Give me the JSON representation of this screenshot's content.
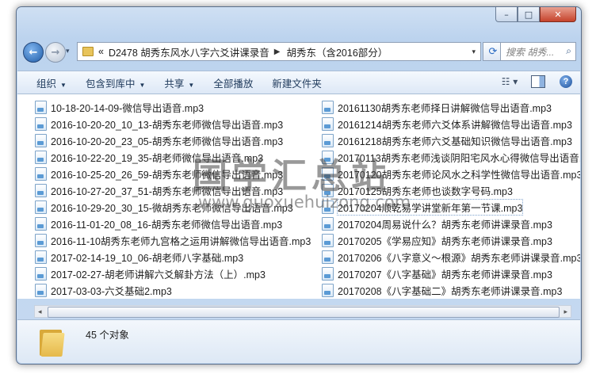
{
  "window": {
    "caption_min": "–",
    "caption_max": "□",
    "caption_close": "✕"
  },
  "nav": {
    "back_glyph": "←",
    "forward_glyph": "→",
    "history_glyph": "▾",
    "address_prefix": "«",
    "address_segments": [
      "D2478 胡秀东风水八字六爻讲课录音",
      "胡秀东（含2016部分）"
    ],
    "address_separator": "▶",
    "dropdown_glyph": "▾",
    "refresh_glyph": "⟳",
    "search_placeholder": "搜索 胡秀...",
    "search_icon": "search-icon"
  },
  "toolbar": {
    "organize": "组织",
    "include_in_library": "包含到库中",
    "share": "共享",
    "play_all": "全部播放",
    "new_folder": "新建文件夹",
    "caret": "▼",
    "view_glyph": "☷ ▾",
    "help_glyph": "?"
  },
  "files": {
    "left": [
      "10-18-20-14-09-微信导出语音.mp3",
      "2016-10-20-20_10_13-胡秀东老师微信导出语音.mp3",
      "2016-10-20-20_23_05-胡秀东老师微信导出语音.mp3",
      "2016-10-22-20_19_35-胡老师微信导出语音.mp3",
      "2016-10-25-20_26_59-胡秀东老师微信导出语音.mp3",
      "2016-10-27-20_37_51-胡秀东老师微信导出语音.mp3",
      "2016-10-29-20_30_15-微胡秀东老师微信导出语音.mp3",
      "2016-11-01-20_08_16-胡秀东老师微信导出语音.mp3",
      "2016-11-10胡秀东老师九宫格之运用讲解微信导出语音.mp3",
      "2017-02-14-19_10_06-胡老师八字基础.mp3",
      "2017-02-27-胡老师讲解六爻解卦方法（上）.mp3",
      "2017-03-03-六爻基础2.mp3"
    ],
    "right": [
      "20161130胡秀东老师择日讲解微信导出语音.mp3",
      "20161214胡秀东老师六爻体系讲解微信导出语音.mp3",
      "20161218胡秀东老师六爻基础知识微信导出语音.mp3",
      "20170113胡秀东老师浅谈阴阳宅风水心得微信导出语音.",
      "20170120胡秀东老师论风水之科学性微信导出语音.mp3",
      "20170125胡秀东老师也谈数字号码.mp3",
      "20170204顺乾易学讲堂新年第一节课.mp3",
      "20170204周易说什么？胡秀东老师讲课录音.mp3",
      "20170205《学易应知》胡秀东老师讲课录音.mp3",
      "20170206《八字意义～根源》胡秀东老师讲课录音.mp3",
      "20170207《八字基础》胡秀东老师讲课录音.mp3",
      "20170208《八字基础二》胡秀东老师讲课录音.mp3"
    ],
    "selected_right_index": 6
  },
  "watermark": {
    "title": "国学汇总站",
    "url": "www.guoxuehuizong.com"
  },
  "scrollbar": {
    "left_glyph": "◂",
    "right_glyph": "▸"
  },
  "details": {
    "count_text": "45 个对象"
  }
}
